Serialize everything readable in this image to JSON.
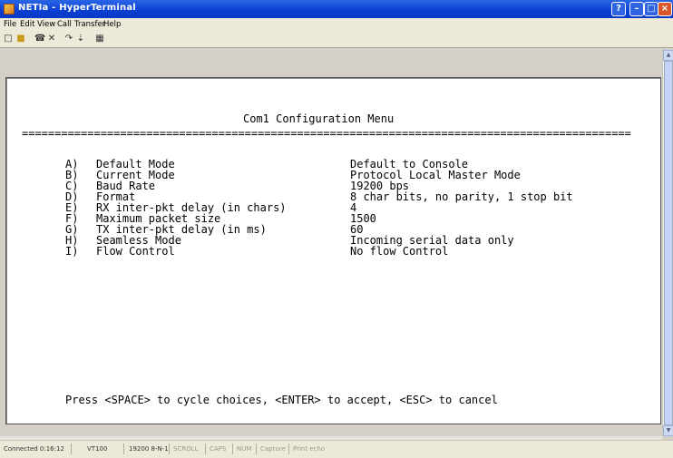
{
  "window": {
    "title": "NETIa - HyperTerminal",
    "help_label": "?",
    "min_label": "–",
    "max_label": "□",
    "close_label": "×"
  },
  "menu": [
    "File",
    "Edit",
    "View",
    "Call",
    "Transfer",
    "Help"
  ],
  "toolbar": {
    "icons": [
      "new-icon",
      "open-icon",
      "call-icon",
      "disconnect-icon",
      "send-icon",
      "receive-icon",
      "properties-icon"
    ]
  },
  "terminal": {
    "heading": "Com1 Configuration Menu",
    "separator": "=============================================================================================",
    "options": [
      {
        "key": "A)",
        "label": "Default Mode",
        "value": "Default to Console"
      },
      {
        "key": "B)",
        "label": "Current Mode",
        "value": "Protocol Local Master Mode"
      },
      {
        "key": "C)",
        "label": "Baud Rate",
        "value": "19200 bps"
      },
      {
        "key": "D)",
        "label": "Format",
        "value": "8 char bits, no parity, 1 stop bit"
      },
      {
        "key": "E)",
        "label": "RX inter-pkt delay (in chars)",
        "value": "4"
      },
      {
        "key": "F)",
        "label": "Maximum packet size",
        "value": "1500"
      },
      {
        "key": "G)",
        "label": "TX inter-pkt delay (in ms)",
        "value": "60"
      },
      {
        "key": "H)",
        "label": "Seamless Mode",
        "value": "Incoming serial data only"
      },
      {
        "key": "I)",
        "label": "Flow Control",
        "value": "No flow Control"
      }
    ],
    "footer": "Press <SPACE> to cycle choices, <ENTER> to accept, <ESC> to cancel"
  },
  "status": {
    "connected": "Connected 0:16:12",
    "terminal_type": "VT100",
    "settings": "19200 8-N-1",
    "scroll": "SCROLL",
    "caps": "CAPS",
    "num": "NUM",
    "capture": "Capture",
    "print_echo": "Print echo"
  }
}
